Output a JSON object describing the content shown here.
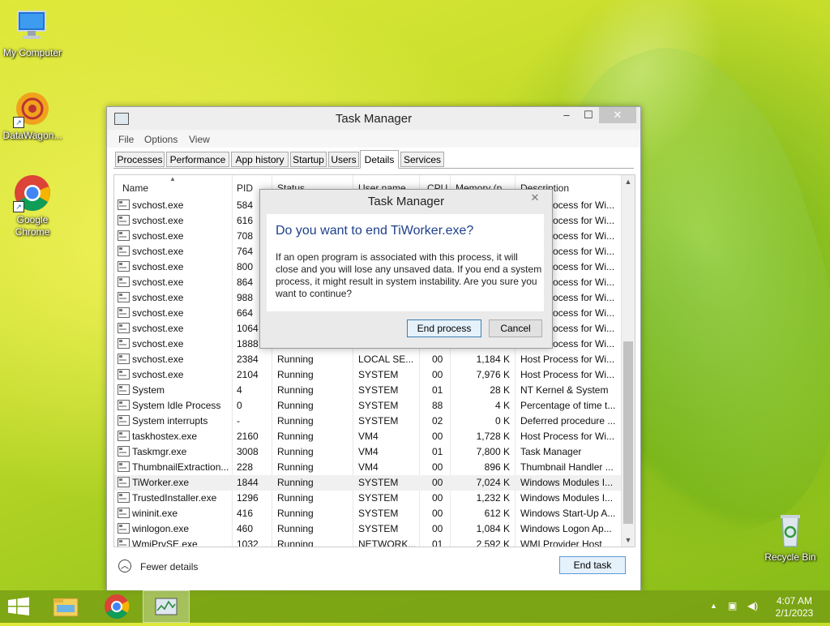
{
  "desktop": {
    "icons": [
      {
        "label": "My Computer"
      },
      {
        "label": "DataWagon..."
      },
      {
        "label": "Google Chrome"
      },
      {
        "label": "Recycle Bin"
      }
    ]
  },
  "window": {
    "title": "Task Manager",
    "menu": [
      "File",
      "Options",
      "View"
    ],
    "tabs": [
      "Processes",
      "Performance",
      "App history",
      "Startup",
      "Users",
      "Details",
      "Services"
    ],
    "active_tab": "Details",
    "columns": [
      "Name",
      "PID",
      "Status",
      "User name",
      "CPU",
      "Memory (p...",
      "Description"
    ],
    "rows": [
      {
        "name": "svchost.exe",
        "pid": "584",
        "status": "",
        "user": "",
        "cpu": "",
        "mem": "",
        "desc": "Host Process for Wi..."
      },
      {
        "name": "svchost.exe",
        "pid": "616",
        "status": "",
        "user": "",
        "cpu": "",
        "mem": "",
        "desc": "Host Process for Wi..."
      },
      {
        "name": "svchost.exe",
        "pid": "708",
        "status": "",
        "user": "",
        "cpu": "",
        "mem": "",
        "desc": "Host Process for Wi..."
      },
      {
        "name": "svchost.exe",
        "pid": "764",
        "status": "",
        "user": "",
        "cpu": "",
        "mem": "",
        "desc": "Host Process for Wi..."
      },
      {
        "name": "svchost.exe",
        "pid": "800",
        "status": "",
        "user": "",
        "cpu": "",
        "mem": "",
        "desc": "Host Process for Wi..."
      },
      {
        "name": "svchost.exe",
        "pid": "864",
        "status": "",
        "user": "",
        "cpu": "",
        "mem": "",
        "desc": "Host Process for Wi..."
      },
      {
        "name": "svchost.exe",
        "pid": "988",
        "status": "",
        "user": "",
        "cpu": "",
        "mem": "",
        "desc": "Host Process for Wi..."
      },
      {
        "name": "svchost.exe",
        "pid": "664",
        "status": "",
        "user": "",
        "cpu": "",
        "mem": "",
        "desc": "Host Process for Wi..."
      },
      {
        "name": "svchost.exe",
        "pid": "1064",
        "status": "",
        "user": "",
        "cpu": "",
        "mem": "",
        "desc": "Host Process for Wi..."
      },
      {
        "name": "svchost.exe",
        "pid": "1888",
        "status": "",
        "user": "",
        "cpu": "",
        "mem": "",
        "desc": "Host Process for Wi..."
      },
      {
        "name": "svchost.exe",
        "pid": "2384",
        "status": "Running",
        "user": "LOCAL SE...",
        "cpu": "00",
        "mem": "1,184 K",
        "desc": "Host Process for Wi..."
      },
      {
        "name": "svchost.exe",
        "pid": "2104",
        "status": "Running",
        "user": "SYSTEM",
        "cpu": "00",
        "mem": "7,976 K",
        "desc": "Host Process for Wi..."
      },
      {
        "name": "System",
        "pid": "4",
        "status": "Running",
        "user": "SYSTEM",
        "cpu": "01",
        "mem": "28 K",
        "desc": "NT Kernel & System"
      },
      {
        "name": "System Idle Process",
        "pid": "0",
        "status": "Running",
        "user": "SYSTEM",
        "cpu": "88",
        "mem": "4 K",
        "desc": "Percentage of time t..."
      },
      {
        "name": "System interrupts",
        "pid": "-",
        "status": "Running",
        "user": "SYSTEM",
        "cpu": "02",
        "mem": "0 K",
        "desc": "Deferred procedure ..."
      },
      {
        "name": "taskhostex.exe",
        "pid": "2160",
        "status": "Running",
        "user": "VM4",
        "cpu": "00",
        "mem": "1,728 K",
        "desc": "Host Process for Wi..."
      },
      {
        "name": "Taskmgr.exe",
        "pid": "3008",
        "status": "Running",
        "user": "VM4",
        "cpu": "01",
        "mem": "7,800 K",
        "desc": "Task Manager"
      },
      {
        "name": "ThumbnailExtraction...",
        "pid": "228",
        "status": "Running",
        "user": "VM4",
        "cpu": "00",
        "mem": "896 K",
        "desc": "Thumbnail Handler ..."
      },
      {
        "name": "TiWorker.exe",
        "pid": "1844",
        "status": "Running",
        "user": "SYSTEM",
        "cpu": "00",
        "mem": "7,024 K",
        "desc": "Windows Modules I...",
        "selected": true
      },
      {
        "name": "TrustedInstaller.exe",
        "pid": "1296",
        "status": "Running",
        "user": "SYSTEM",
        "cpu": "00",
        "mem": "1,232 K",
        "desc": "Windows Modules I..."
      },
      {
        "name": "wininit.exe",
        "pid": "416",
        "status": "Running",
        "user": "SYSTEM",
        "cpu": "00",
        "mem": "612 K",
        "desc": "Windows Start-Up A..."
      },
      {
        "name": "winlogon.exe",
        "pid": "460",
        "status": "Running",
        "user": "SYSTEM",
        "cpu": "00",
        "mem": "1,084 K",
        "desc": "Windows Logon Ap..."
      },
      {
        "name": "WmiPrvSE.exe",
        "pid": "1032",
        "status": "Running",
        "user": "NETWORK...",
        "cpu": "01",
        "mem": "2,592 K",
        "desc": "WMI Provider Host"
      }
    ],
    "fewer_details": "Fewer details",
    "end_task": "End task"
  },
  "dialog": {
    "title": "Task Manager",
    "heading": "Do you want to end TiWorker.exe?",
    "message": "If an open program is associated with this process, it will close and you will lose any unsaved data. If you end a system process, it might result in system instability. Are you sure you want to continue?",
    "ok": "End process",
    "cancel": "Cancel"
  },
  "taskbar": {
    "time": "4:07 AM",
    "date": "2/1/2023"
  },
  "colors": {
    "accent": "#1e3f8a",
    "selection": "#f0f0f0",
    "button_border": "#3c7fb1"
  }
}
